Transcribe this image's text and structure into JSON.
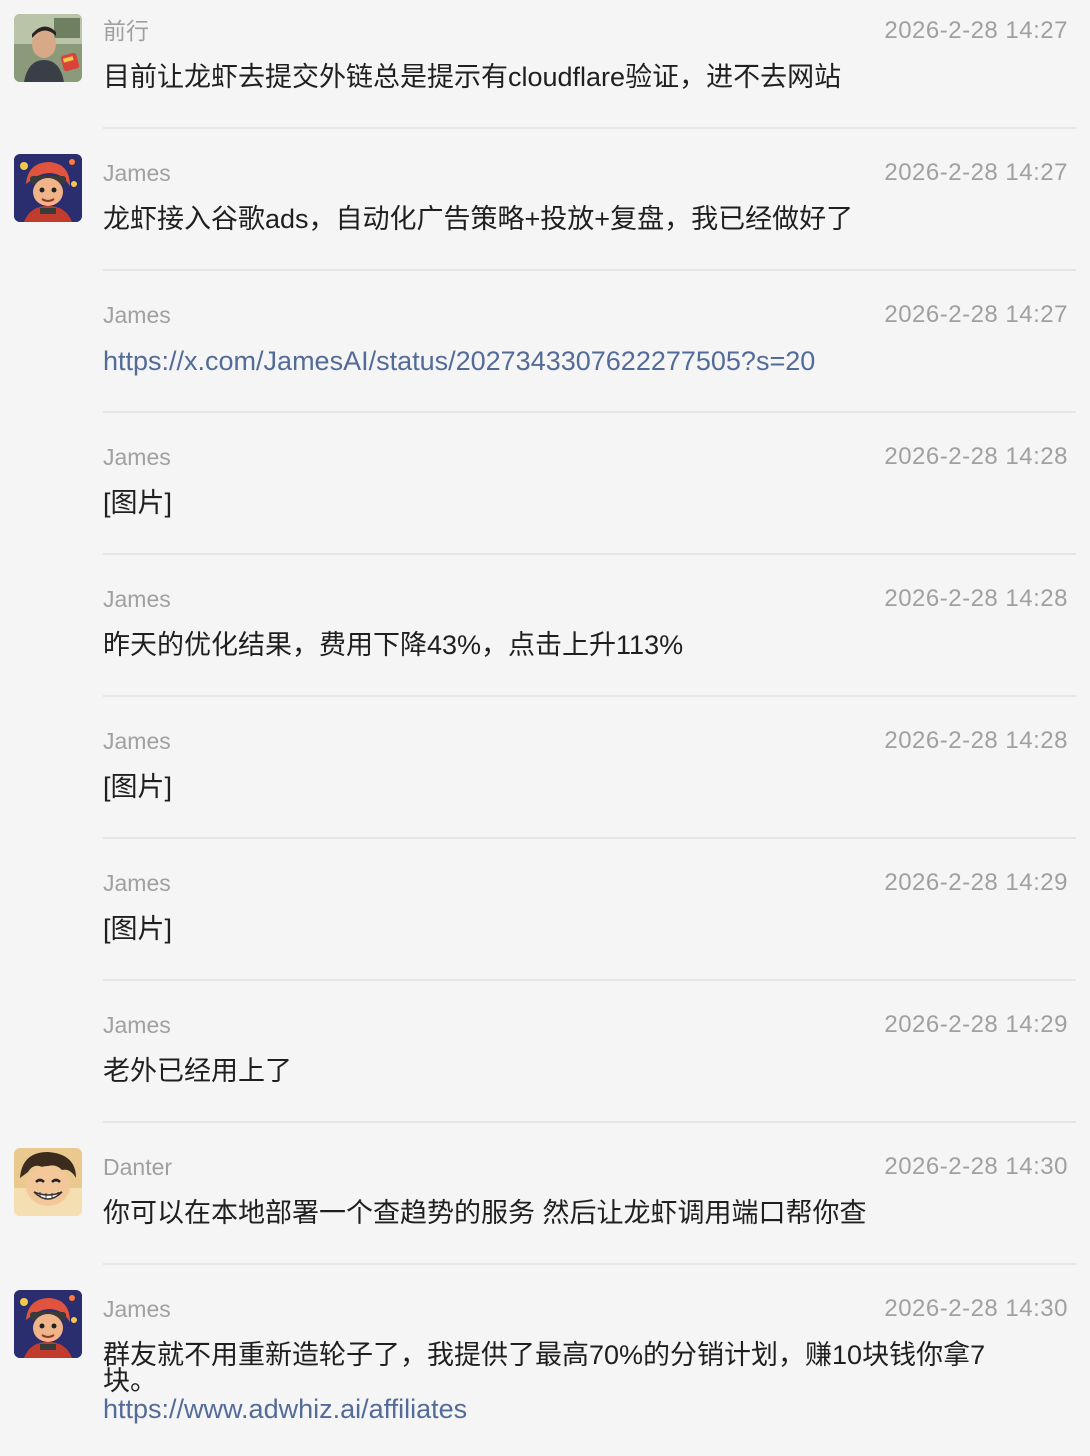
{
  "messages": [
    {
      "sender": "前行",
      "time": "2026-2-28 14:27",
      "text": "目前让龙虾去提交外链总是提示有cloudflare验证，进不去网站",
      "avatar": "photo-avatar-qianxing"
    },
    {
      "sender": "James",
      "time": "2026-2-28 14:27",
      "text": "龙虾接入谷歌ads，自动化广告策略+投放+复盘，我已经做好了",
      "avatar": "cartoon-avatar-james"
    },
    {
      "sender": "James",
      "time": "2026-2-28 14:27",
      "link": "https://x.com/JamesAI/status/2027343307622277505?s=20"
    },
    {
      "sender": "James",
      "time": "2026-2-28 14:28",
      "text": "[图片]"
    },
    {
      "sender": "James",
      "time": "2026-2-28 14:28",
      "text": "昨天的优化结果，费用下降43%，点击上升113%"
    },
    {
      "sender": "James",
      "time": "2026-2-28 14:28",
      "text": "[图片]"
    },
    {
      "sender": "James",
      "time": "2026-2-28 14:29",
      "text": "[图片]"
    },
    {
      "sender": "James",
      "time": "2026-2-28 14:29",
      "text": "老外已经用上了"
    },
    {
      "sender": "Danter",
      "time": "2026-2-28 14:30",
      "text": "你可以在本地部署一个查趋势的服务 然后让龙虾调用端口帮你查",
      "avatar": "cartoon-avatar-danter"
    },
    {
      "sender": "James",
      "time": "2026-2-28 14:30",
      "text_line1": "群友就不用重新造轮子了，我提供了最高70%的分销计划，赚10块钱你拿7",
      "text_line2": "块。",
      "link": "https://www.adwhiz.ai/affiliates",
      "avatar": "cartoon-avatar-james"
    }
  ]
}
